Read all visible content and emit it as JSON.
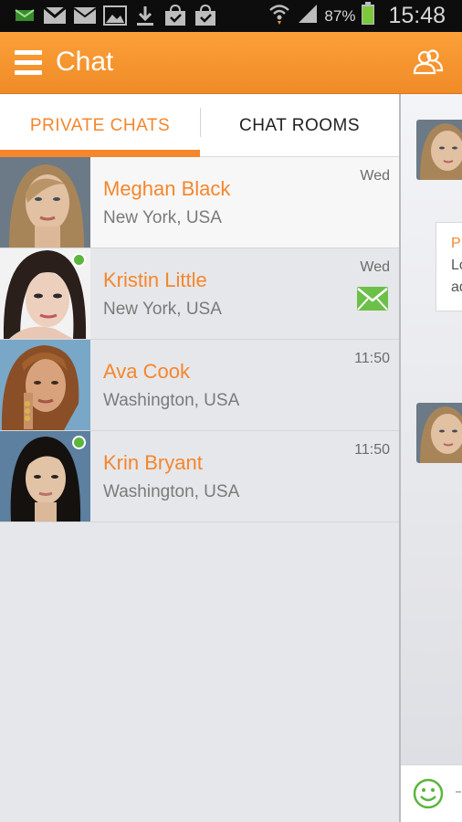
{
  "status_bar": {
    "icons": [
      "email-notification-icon",
      "gmail-icon",
      "mail-icon",
      "gallery-icon",
      "download-icon",
      "shopping-bag-icon",
      "shopping-bag-check-icon",
      "wifi-icon",
      "signal-icon",
      "battery-icon"
    ],
    "battery_percent": "87%",
    "time": "15:48"
  },
  "app_bar": {
    "title": "Chat",
    "icons": [
      "hamburger-menu-icon",
      "people-icon"
    ]
  },
  "tabs": [
    {
      "label": "PRIVATE CHATS",
      "active": true
    },
    {
      "label": "CHAT ROOMS",
      "active": false
    }
  ],
  "chats": [
    {
      "name": "Meghan Black",
      "location": "New York, USA",
      "time": "Wed",
      "online": false,
      "unread": false,
      "selected": true
    },
    {
      "name": "Kristin Little",
      "location": "New York, USA",
      "time": "Wed",
      "online": true,
      "unread": true,
      "selected": false
    },
    {
      "name": "Ava Cook",
      "location": "Washington, USA",
      "time": "11:50",
      "online": false,
      "unread": false,
      "selected": false
    },
    {
      "name": "Krin Bryant",
      "location": "Washington, USA",
      "time": "11:50",
      "online": true,
      "unread": false,
      "selected": false
    }
  ],
  "conversation_peek": {
    "bubble_sender_initial": "P",
    "bubble_line1": "Lo",
    "bubble_line2": "ad",
    "composer_placeholder_fragment": "-"
  },
  "colors": {
    "accent": "#f5862c",
    "online": "#5cb53d",
    "unread_icon": "#6cc04a",
    "app_bar": "#f4902c"
  }
}
